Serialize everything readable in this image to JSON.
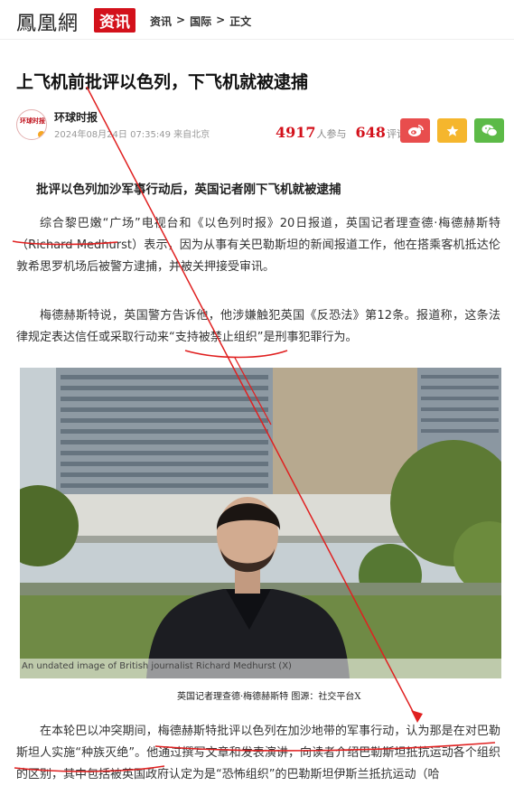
{
  "header": {
    "logo_text": "鳳凰網",
    "badge_text": "资讯",
    "breadcrumb": [
      "资讯",
      "国际",
      "正文"
    ],
    "breadcrumb_separator": ">"
  },
  "article": {
    "title": "上飞机前批评以色列，下飞机就被逮捕",
    "source_name": "环球时报",
    "avatar_text": "环球时报",
    "date": "2024年08月24日 07:35:49 来自北京",
    "participants_count": "4917",
    "participants_label": "人参与",
    "comments_count": "648",
    "comments_label": "评论",
    "lead": "批评以色列加沙军事行动后，英国记者刚下飞机就被逮捕",
    "p1": "综合黎巴嫩“广场”电视台和《以色列时报》20日报道，英国记者理查德·梅德赫斯特（Richard Medhurst）表示，因为从事有关巴勒斯坦的新闻报道工作，他在搭乘客机抵达伦敦希思罗机场后被警方逮捕，并被关押接受审讯。",
    "p2": "梅德赫斯特说，英国警方告诉他，他涉嫌触犯英国《反恐法》第12条。报道称，这条法律规定表达信任或采取行动来“支持被禁止组织”是刑事犯罪行为。",
    "photo_caption": "An undated image of British journalist Richard Medhurst (X)",
    "caption": "英国记者理查德·梅德赫斯特 图源：社交平台X",
    "p3": "在本轮巴以冲突期间，梅德赫斯特批评以色列在加沙地带的军事行动，认为那是在对巴勒斯坦人实施“种族灭绝”。他通过撰写文章和发表演讲，向读者介绍巴勒斯坦抵抗运动各个组织的区别，其中包括被英国政府认定为是“恐怖组织”的巴勒斯坦伊斯兰抵抗运动（哈"
  },
  "icons": [
    "weibo-share-icon",
    "star-icon",
    "wechat-share-icon"
  ],
  "colors": {
    "brand_red": "#d3111b",
    "annotation_red": "#e02020",
    "weibo": "#e84d4d",
    "favorite": "#f5b62d",
    "wechat": "#5cba47"
  }
}
